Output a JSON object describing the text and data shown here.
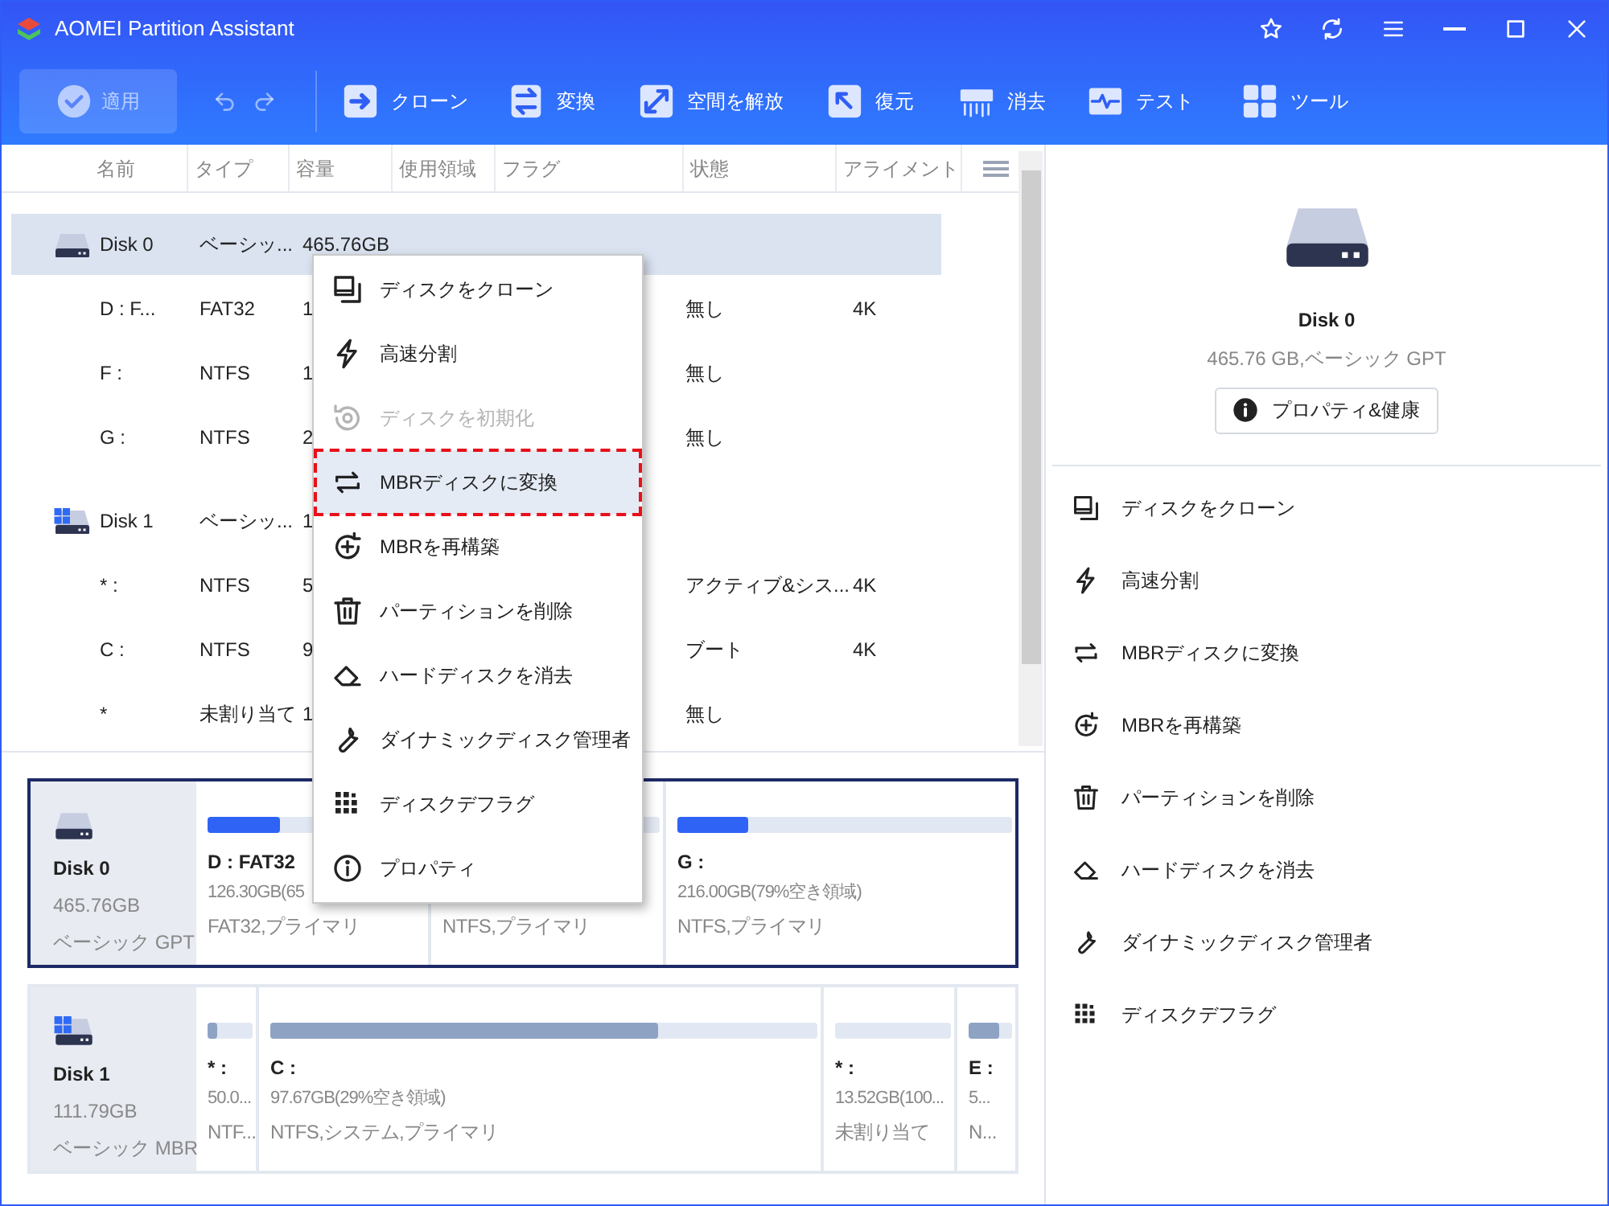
{
  "window": {
    "title": "AOMEI Partition Assistant"
  },
  "toolbar": {
    "apply": {
      "label": "適用",
      "disabled": true
    },
    "tools": [
      {
        "label": "クローン"
      },
      {
        "label": "変換"
      },
      {
        "label": "空間を解放"
      },
      {
        "label": "復元"
      },
      {
        "label": "消去"
      },
      {
        "label": "テスト"
      },
      {
        "label": "ツール"
      }
    ]
  },
  "table": {
    "columns": [
      "名前",
      "タイプ",
      "容量",
      "使用領域",
      "フラグ",
      "状態",
      "アライメント"
    ],
    "rows": [
      {
        "kind": "disk",
        "system_disk": false,
        "selected": true,
        "name": "Disk 0",
        "type": "ベーシッ...",
        "capacity": "465.76GB"
      },
      {
        "kind": "partition",
        "selected": false,
        "name": "D : F...",
        "type": "FAT32",
        "capacity": "1",
        "state": "無し",
        "alignment": "4K"
      },
      {
        "kind": "partition",
        "selected": false,
        "name": "F :",
        "type": "NTFS",
        "capacity": "1",
        "state": "無し"
      },
      {
        "kind": "partition",
        "selected": false,
        "name": "G :",
        "type": "NTFS",
        "capacity": "2",
        "state": "無し"
      },
      {
        "kind": "disk",
        "system_disk": true,
        "selected": false,
        "name": "Disk 1",
        "type": "ベーシッ...",
        "capacity": "1"
      },
      {
        "kind": "partition",
        "selected": false,
        "name": "* :",
        "type": "NTFS",
        "capacity": "5",
        "state": "アクティブ&シス...",
        "alignment": "4K"
      },
      {
        "kind": "partition",
        "selected": false,
        "name": "C :",
        "type": "NTFS",
        "capacity": "9",
        "state": "ブート",
        "alignment": "4K"
      },
      {
        "kind": "partition",
        "selected": false,
        "name": "*",
        "type": "未割り当て",
        "capacity": "1",
        "state": "無し"
      }
    ]
  },
  "context_menu": {
    "items": [
      {
        "label": "ディスクをクローン",
        "disabled": false,
        "selected": false
      },
      {
        "label": "高速分割",
        "disabled": false,
        "selected": false
      },
      {
        "label": "ディスクを初期化",
        "disabled": true,
        "selected": false
      },
      {
        "label": "MBRディスクに変換",
        "disabled": false,
        "selected": true
      },
      {
        "label": "MBRを再構築",
        "disabled": false,
        "selected": false
      },
      {
        "label": "パーティションを削除",
        "disabled": false,
        "selected": false
      },
      {
        "label": "ハードディスクを消去",
        "disabled": false,
        "selected": false
      },
      {
        "label": "ダイナミックディスク管理者",
        "disabled": false,
        "selected": false
      },
      {
        "label": "ディスクデフラグ",
        "disabled": false,
        "selected": false
      },
      {
        "label": "プロパティ",
        "disabled": false,
        "selected": false
      }
    ]
  },
  "disk_map": [
    {
      "name": "Disk 0",
      "size": "465.76GB",
      "type": "ベーシック GPT",
      "selected": true,
      "system_disk": false,
      "partitions": [
        {
          "label": "D : FAT32",
          "info": "126.30GB(65",
          "type": "FAT32,プライマリ",
          "level": 0.33
        },
        {
          "type": "NTFS,プライマリ"
        },
        {
          "label": "G :",
          "info": "216.00GB(79%空き領域)",
          "type": "NTFS,プライマリ",
          "level": 0.21
        }
      ]
    },
    {
      "name": "Disk 1",
      "size": "111.79GB",
      "type": "ベーシック MBR",
      "selected": false,
      "system_disk": true,
      "partitions": [
        {
          "label": "* :",
          "info": "50.0...",
          "type": "NTF...",
          "level": 0.2
        },
        {
          "label": "C :",
          "info": "97.67GB(29%空き領域)",
          "type": "NTFS,システム,プライマリ",
          "level": 0.71
        },
        {
          "label": "* :",
          "info": "13.52GB(100...",
          "type": "未割り当て"
        },
        {
          "label": "E :",
          "info": "5...",
          "type": "N...",
          "level": 0.7
        }
      ]
    }
  ],
  "details": {
    "disk_name": "Disk 0",
    "summary": "465.76 GB,ベーシック GPT",
    "button": "プロパティ&健康",
    "operations": [
      "ディスクをクローン",
      "高速分割",
      "MBRディスクに変換",
      "MBRを再構築",
      "パーティションを削除",
      "ハードディスクを消去",
      "ダイナミックディスク管理者",
      "ディスクデフラグ"
    ]
  }
}
